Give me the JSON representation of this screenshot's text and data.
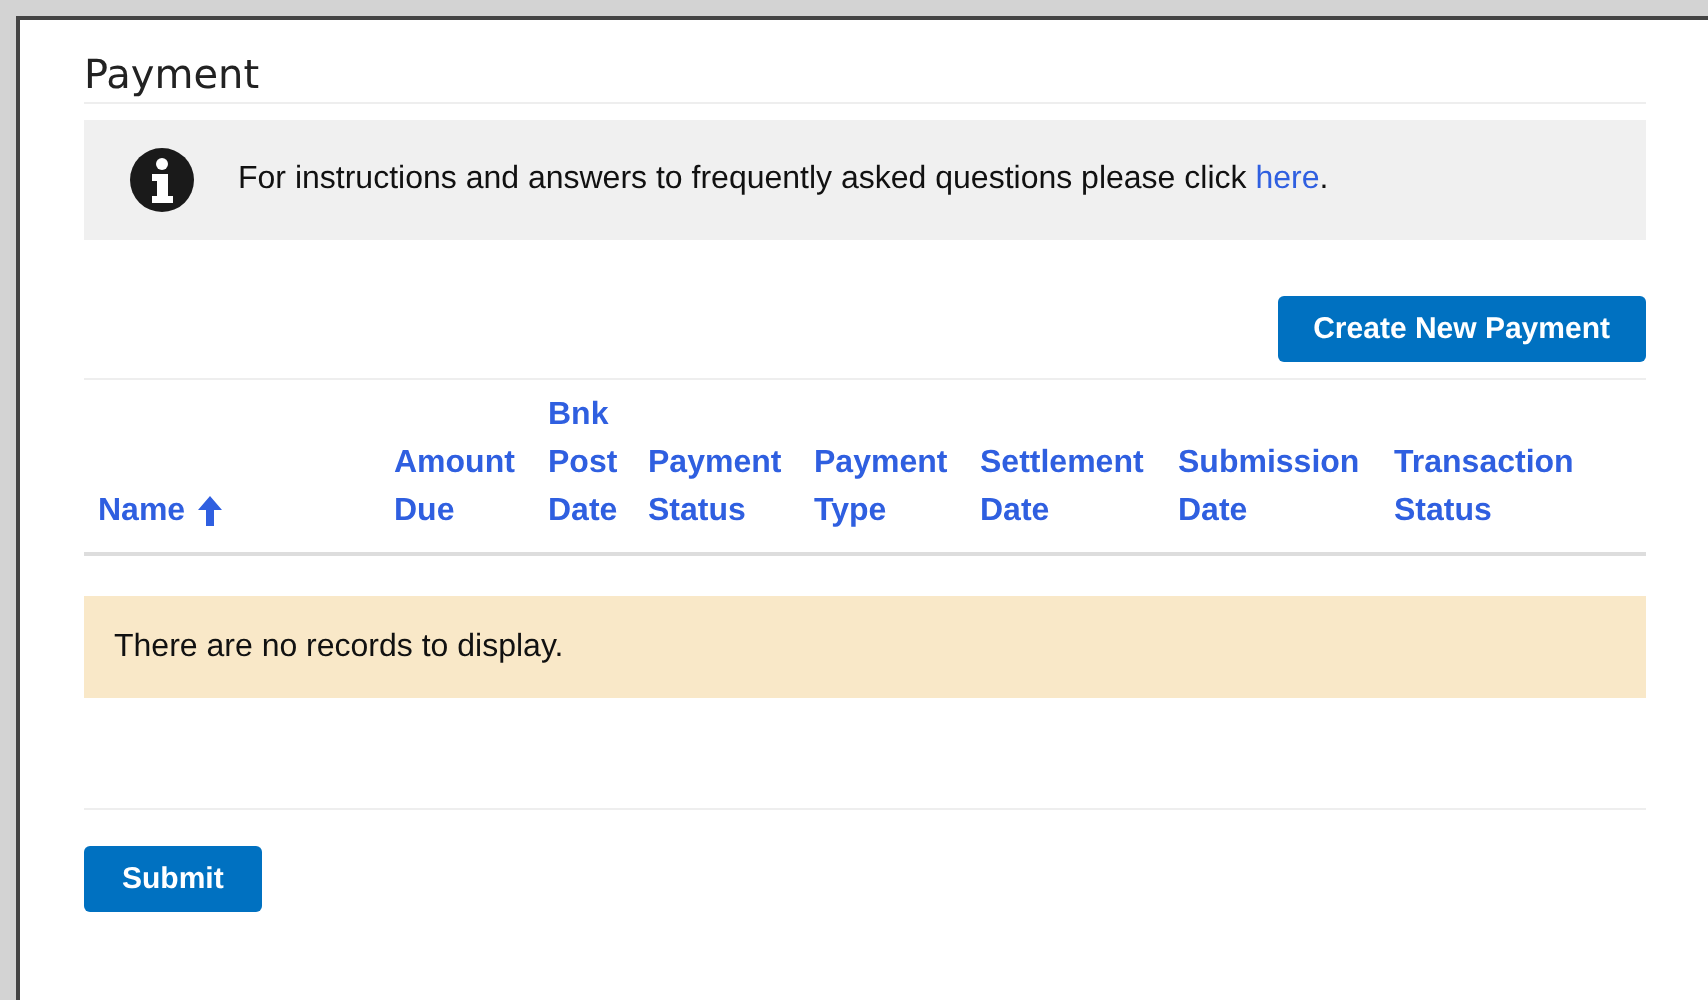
{
  "title": "Payment",
  "notice": {
    "text": "For instructions and answers to frequently asked questions please click",
    "link": "here",
    "after": "."
  },
  "actions": [
    "Create New Payment"
  ],
  "table": {
    "columns": [
      {
        "label": "Name",
        "sorted": true
      },
      {
        "label": "Amount Due",
        "sorted": false
      },
      {
        "label": "Bnk Post Date",
        "sorted": false
      },
      {
        "label": "Payment Status",
        "sorted": false
      },
      {
        "label": "Payment Type",
        "sorted": false
      },
      {
        "label": "Settlement Date",
        "sorted": false
      },
      {
        "label": "Submission Date",
        "sorted": false
      },
      {
        "label": "Transaction Status",
        "sorted": false
      }
    ],
    "empty_message": "There are no records to display."
  },
  "buttons": [
    "Submit"
  ]
}
